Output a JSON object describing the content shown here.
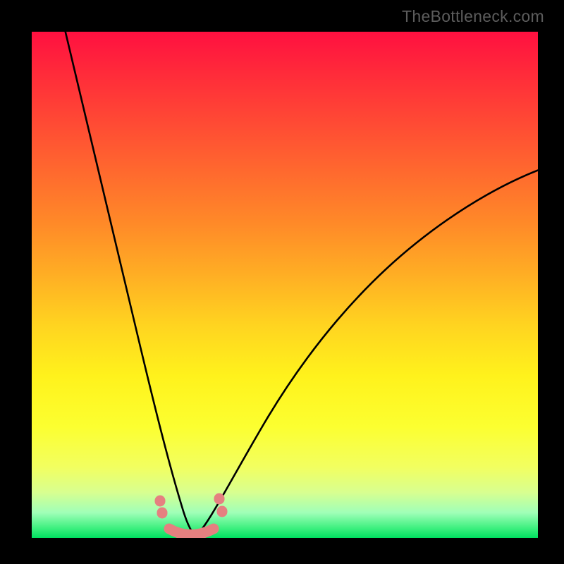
{
  "watermark": "TheBottleneck.com",
  "chart_data": {
    "type": "line",
    "title": "",
    "xlabel": "",
    "ylabel": "",
    "xlim": [
      0,
      1
    ],
    "ylim": [
      0,
      1
    ],
    "grid": false,
    "legend": false,
    "background_gradient": {
      "orientation": "vertical",
      "stops": [
        {
          "pos": 0.0,
          "color": "#ff1040"
        },
        {
          "pos": 0.5,
          "color": "#ffc020"
        },
        {
          "pos": 0.8,
          "color": "#f8ff40"
        },
        {
          "pos": 1.0,
          "color": "#00e060"
        }
      ]
    },
    "series": [
      {
        "name": "bottleneck-curve-left",
        "stroke": "#000000",
        "x": [
          0.06,
          0.1,
          0.14,
          0.18,
          0.22,
          0.255,
          0.275,
          0.29,
          0.3
        ],
        "y": [
          1.0,
          0.78,
          0.56,
          0.36,
          0.19,
          0.07,
          0.025,
          0.008,
          0.004
        ]
      },
      {
        "name": "bottleneck-curve-right",
        "stroke": "#000000",
        "x": [
          0.3,
          0.32,
          0.35,
          0.4,
          0.47,
          0.56,
          0.67,
          0.8,
          0.95,
          1.0
        ],
        "y": [
          0.004,
          0.012,
          0.045,
          0.135,
          0.275,
          0.42,
          0.555,
          0.665,
          0.74,
          0.76
        ]
      },
      {
        "name": "optimal-marker-band",
        "stroke": "#e58080",
        "style": "thick-dotted",
        "x": [
          0.245,
          0.26,
          0.285,
          0.31,
          0.335,
          0.35
        ],
        "y": [
          0.062,
          0.03,
          0.01,
          0.01,
          0.03,
          0.06
        ]
      }
    ],
    "annotations": []
  }
}
